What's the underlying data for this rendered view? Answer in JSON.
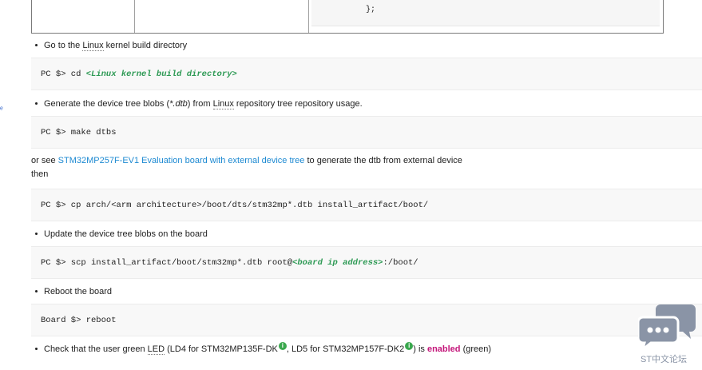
{
  "top_table": {
    "code_tail": "};"
  },
  "steps": {
    "go_to_kernel": {
      "pre": "Go to the ",
      "linux": "Linux",
      "post": " kernel build directory"
    },
    "cd_cmd": {
      "prompt": "PC $> cd ",
      "placeholder": "<Linux kernel build directory>"
    },
    "generate": {
      "pre": "Generate the device tree blobs (",
      "ext": "*.dtb",
      "mid": ") from ",
      "linux": "Linux",
      "post": " repository tree repository usage."
    },
    "make_cmd": "PC $> make dtbs",
    "or_see": {
      "pre": "or see ",
      "link": "STM32MP257F-EV1 Evaluation board with external device tree",
      "post": " to generate the dtb from external device"
    },
    "then": "then",
    "cp_cmd": "PC $> cp arch/<arm architecture>/boot/dts/stm32mp*.dtb install_artifact/boot/",
    "update": "Update the device tree blobs on the board",
    "scp_cmd": {
      "pre": "PC $> scp install_artifact/boot/stm32mp*.dtb root@",
      "placeholder": "<board ip address>",
      "post": ":/boot/"
    },
    "reboot": "Reboot the board",
    "reboot_cmd": "Board $> reboot",
    "check": {
      "pre": "Check that the user green ",
      "led": "LED",
      "mid1": " (LD4 for STM32MP135F-DK",
      "mid2": ", LD5 for STM32MP157F-DK2",
      "mid3": ") is ",
      "enabled": "enabled",
      "post": " (green)",
      "info_icon": "i"
    }
  },
  "chat_widget": {
    "label": "ST中文论坛",
    "icon": "chat-bubbles-icon"
  },
  "colors": {
    "link": "#1e8ad2",
    "placeholder": "#2e9a55",
    "enabled": "#c4157a",
    "info": "#3aa84e",
    "chat": "#8a94a6"
  }
}
